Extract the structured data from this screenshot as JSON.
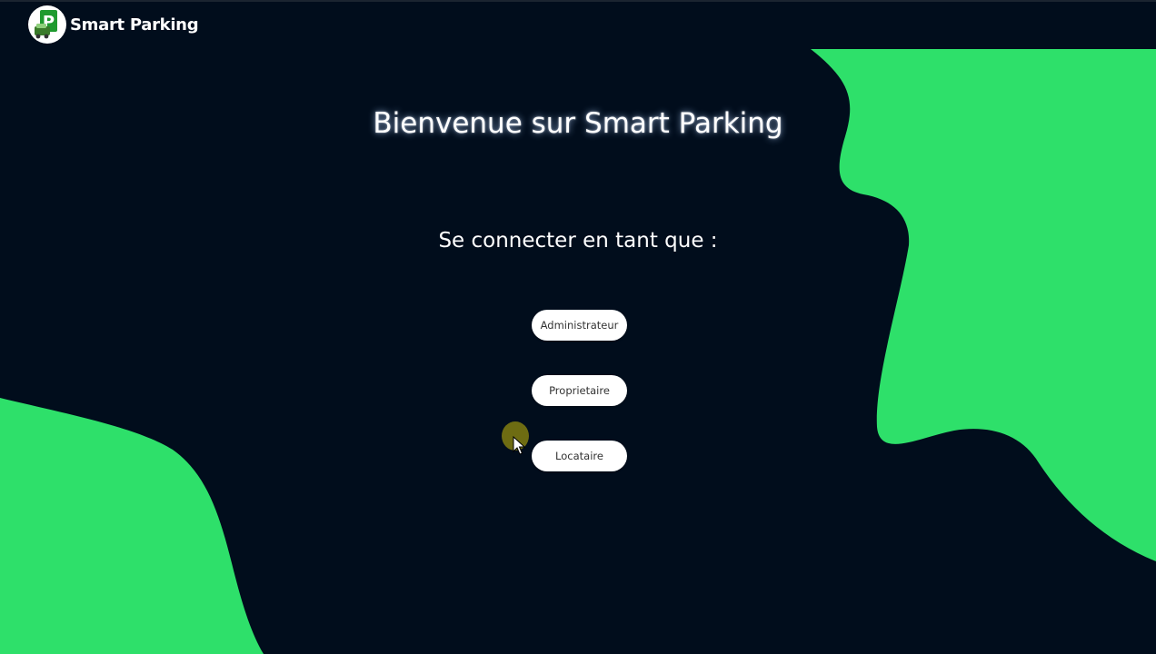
{
  "brand": {
    "name": "Smart Parking",
    "logo_icon": "parking-p-icon"
  },
  "main": {
    "title": "Bienvenue sur Smart Parking",
    "subtitle": "Se connecter en tant que :",
    "roles": [
      {
        "label": "Administrateur"
      },
      {
        "label": "Proprietaire"
      },
      {
        "label": "Locataire"
      }
    ]
  },
  "colors": {
    "background": "#010d1c",
    "accent_green": "#2ee06a",
    "button_bg": "#ffffff",
    "text": "#ffffff"
  }
}
